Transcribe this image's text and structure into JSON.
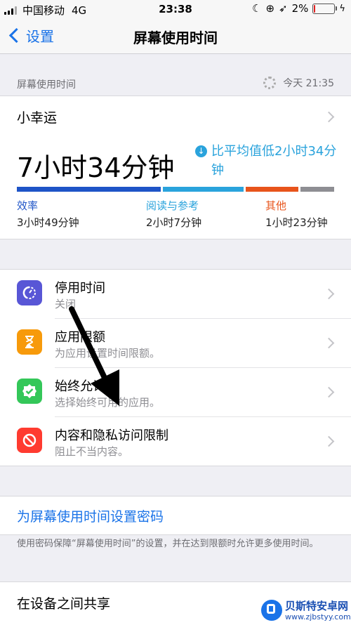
{
  "status_bar": {
    "carrier": "中国移动",
    "network": "4G",
    "time": "23:38",
    "battery": "2%"
  },
  "nav": {
    "back_label": "设置",
    "title": "屏幕使用时间"
  },
  "section_header": {
    "label": "屏幕使用时间",
    "updated": "今天 21:35"
  },
  "user": {
    "name": "小幸运"
  },
  "summary": {
    "total": "7小时34分钟",
    "comparison": "比平均值低2小时34分钟",
    "categories": [
      {
        "name": "效率",
        "time": "3小时49分钟",
        "color": "#1e54c7"
      },
      {
        "name": "阅读与参考",
        "time": "2小时7分钟",
        "color": "#2aa3dc"
      },
      {
        "name": "其他",
        "time": "1小时23分钟",
        "color": "#e8541b"
      }
    ],
    "bar_colors": [
      "#1e54c7",
      "#2aa3dc",
      "#e8541b",
      "#8e8e93"
    ]
  },
  "menu": [
    {
      "title": "停用时间",
      "subtitle": "关闭",
      "icon": "downtime-icon",
      "color": "#5856d6"
    },
    {
      "title": "应用限额",
      "subtitle": "为应用设置时间限额。",
      "icon": "hourglass-icon",
      "color": "#f79a0b"
    },
    {
      "title": "始终允许",
      "subtitle": "选择始终可用的应用。",
      "icon": "checkmark-badge-icon",
      "color": "#34c759"
    },
    {
      "title": "内容和隐私访问限制",
      "subtitle": "阻止不当内容。",
      "icon": "restriction-icon",
      "color": "#ff3b30"
    }
  ],
  "passcode": {
    "link": "为屏幕使用时间设置密码",
    "note": "使用密码保障“屏幕使用时间”的设置，并在达到限额时允许更多使用时间。"
  },
  "share": {
    "label": "在设备之间共享"
  },
  "watermark": {
    "name": "贝斯特安卓网",
    "url": "www.zjbstyy.com"
  }
}
